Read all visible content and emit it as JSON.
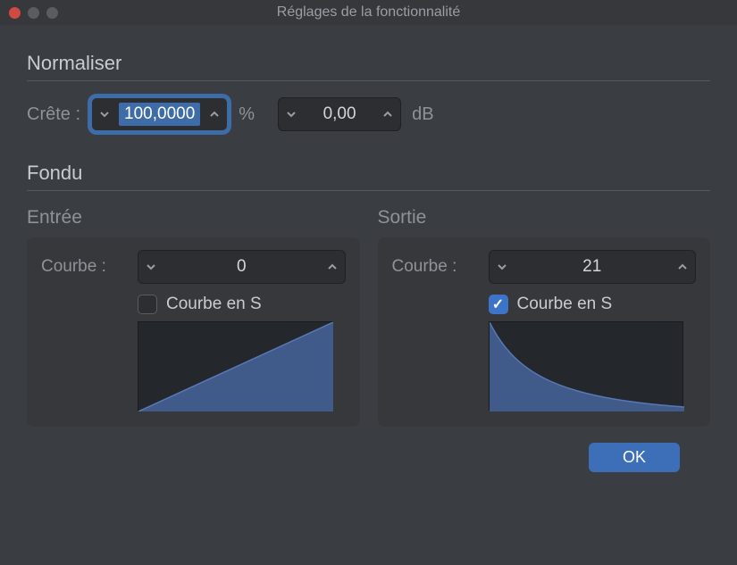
{
  "title": "Réglages de la fonctionnalité",
  "normalize": {
    "heading": "Normaliser",
    "peak_label": "Crête :",
    "peak_value": "100,0000",
    "percent_unit": "%",
    "db_value": "0,00",
    "db_unit": "dB"
  },
  "fade": {
    "heading": "Fondu",
    "in": {
      "title": "Entrée",
      "curve_label": "Courbe :",
      "curve_value": "0",
      "s_curve_label": "Courbe en S",
      "s_curve_checked": false
    },
    "out": {
      "title": "Sortie",
      "curve_label": "Courbe :",
      "curve_value": "21",
      "s_curve_label": "Courbe en S",
      "s_curve_checked": true
    }
  },
  "footer": {
    "ok": "OK"
  },
  "chart_data": [
    {
      "type": "line",
      "title": "Fade In Curve",
      "xlabel": "",
      "ylabel": "",
      "x": [
        0,
        1
      ],
      "values": [
        0,
        1
      ],
      "shape": "linear"
    },
    {
      "type": "line",
      "title": "Fade Out Curve",
      "xlabel": "",
      "ylabel": "",
      "x": [
        0,
        0.1,
        0.2,
        0.35,
        0.5,
        0.7,
        1
      ],
      "values": [
        1,
        0.55,
        0.38,
        0.25,
        0.17,
        0.1,
        0.05
      ],
      "shape": "concave-decay"
    }
  ]
}
